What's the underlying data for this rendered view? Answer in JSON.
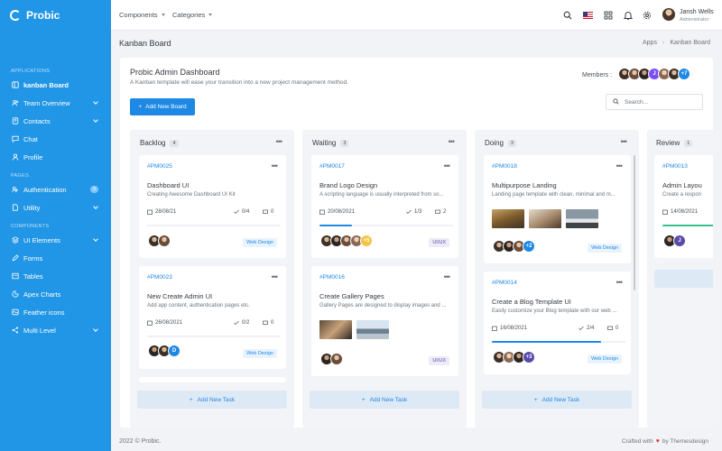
{
  "sidebar": {
    "brand": "Probic",
    "sections": {
      "applications": "APPLICATIONS",
      "pages": "PAGES",
      "components": "COMPONENTS"
    },
    "items": [
      {
        "label": "kanban Board",
        "icon": "board-icon"
      },
      {
        "label": "Team Overview",
        "icon": "users-icon"
      },
      {
        "label": "Contacts",
        "icon": "contacts-icon"
      },
      {
        "label": "Chat",
        "icon": "chat-icon"
      },
      {
        "label": "Profile",
        "icon": "user-icon"
      },
      {
        "label": "Authentication",
        "icon": "key-icon",
        "badge": "9"
      },
      {
        "label": "Utility",
        "icon": "file-icon"
      },
      {
        "label": "UI Elements",
        "icon": "layers-icon"
      },
      {
        "label": "Forms",
        "icon": "edit-icon"
      },
      {
        "label": "Tables",
        "icon": "table-icon"
      },
      {
        "label": "Apex Charts",
        "icon": "chart-icon"
      },
      {
        "label": "Feather icons",
        "icon": "feather-icon"
      },
      {
        "label": "Multi Level",
        "icon": "share-icon"
      }
    ]
  },
  "topbar": {
    "components": "Components",
    "categories": "Categories",
    "user_name": "Jansh Wells",
    "user_role": "Administrator"
  },
  "page": {
    "title": "Kanban Board",
    "breadcrumb": [
      "Apps",
      "Kanban Board"
    ]
  },
  "dashboard": {
    "title": "Probic Admin Dashboard",
    "subtitle": "A Kanban template will ease your transition into a new project management method.",
    "members_label": "Members :",
    "members_more": "+7",
    "member_initial": "J",
    "add_board": "Add New Board",
    "search_placeholder": "Search..."
  },
  "columns": [
    {
      "name": "Backlog",
      "count": "4",
      "tasks": [
        {
          "id": "#PM0025",
          "title": "Dashboard UI",
          "desc": "Creating Awesome Dashboard UI Kit",
          "date": "28/08/21",
          "checks": "0/4",
          "comments": "0",
          "progress": 0.0,
          "tag": "Web Design"
        },
        {
          "id": "#PM0023",
          "title": "New Create Admin UI",
          "desc": "Add app content, authentication pages etc.",
          "date": "26/08/2021",
          "checks": "0/2",
          "comments": "0",
          "progress": 0.0,
          "tag": "Web Design",
          "avatar_letter": "D"
        }
      ]
    },
    {
      "name": "Waiting",
      "count": "3",
      "tasks": [
        {
          "id": "#PM0017",
          "title": "Brand Logo Design",
          "desc": "A scripting language is usually interpreted from so...",
          "date": "20/08/2021",
          "checks": "1/3",
          "comments": "2",
          "progress": 0.24,
          "tag": "UI/UX",
          "more": "+5"
        },
        {
          "id": "#PM0016",
          "title": "Create Gallery Pages",
          "desc": "Gallery Pages are designed to display images and ...",
          "tag": "UI/UX"
        }
      ]
    },
    {
      "name": "Doing",
      "count": "3",
      "tasks": [
        {
          "id": "#PM0018",
          "title": "Multipurpose Landing",
          "desc": "Landing page template with clean, minimal and m...",
          "tag": "Web Design",
          "more": "+2"
        },
        {
          "id": "#PM0014",
          "title": "Create a Blog Template UI",
          "desc": "Easily customize your Blog template with our web ...",
          "date": "16/08/2021",
          "checks": "2/4",
          "comments": "0",
          "progress": 0.82,
          "tag": "Web Design",
          "more": "+3"
        }
      ]
    },
    {
      "name": "Review",
      "count": "1",
      "tasks": [
        {
          "id": "#PM0013",
          "title": "Admin Layou",
          "desc": "Create a respon",
          "date": "14/08/2021",
          "progress": 1.0,
          "avatar_letter": "J"
        }
      ]
    }
  ],
  "add_task": "Add New Task",
  "footer": {
    "copyright": "2022 © Probic.",
    "crafted": "Crafted with",
    "by": "by Themesdesign"
  },
  "colors": {
    "sidebar": "#2196e6",
    "primary": "#1e88e5",
    "green": "#34c38f"
  }
}
